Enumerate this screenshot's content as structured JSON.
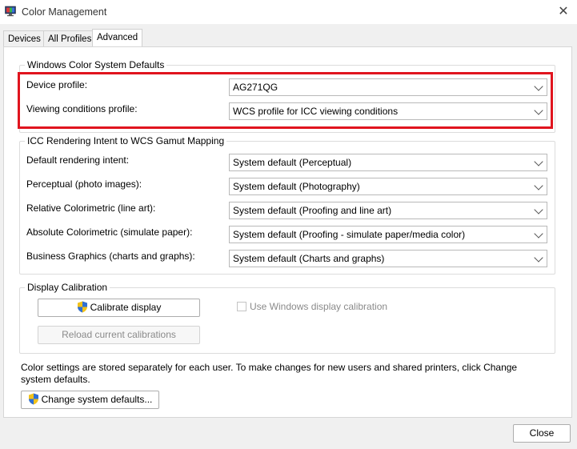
{
  "window": {
    "title": "Color Management",
    "close_glyph": "✕"
  },
  "tabs": [
    {
      "label": "Devices"
    },
    {
      "label": "All Profiles"
    },
    {
      "label": "Advanced"
    }
  ],
  "wcs_defaults": {
    "legend": "Windows Color System Defaults",
    "rows": [
      {
        "label": "Device profile:",
        "value": "AG271QG"
      },
      {
        "label": "Viewing conditions profile:",
        "value": "WCS profile for ICC viewing conditions"
      }
    ]
  },
  "icc_mapping": {
    "legend": "ICC Rendering Intent to WCS Gamut Mapping",
    "rows": [
      {
        "label": "Default rendering intent:",
        "value": "System default (Perceptual)"
      },
      {
        "label": "Perceptual (photo images):",
        "value": "System default (Photography)"
      },
      {
        "label": "Relative Colorimetric (line art):",
        "value": "System default (Proofing and line art)"
      },
      {
        "label": "Absolute Colorimetric (simulate paper):",
        "value": "System default (Proofing - simulate paper/media color)"
      },
      {
        "label": "Business Graphics (charts and graphs):",
        "value": "System default (Charts and graphs)"
      }
    ]
  },
  "calibration": {
    "legend": "Display Calibration",
    "calibrate_label": "Calibrate display",
    "reload_label": "Reload current calibrations",
    "use_windows_label": "Use Windows display calibration",
    "use_windows_checked": false
  },
  "info_text": "Color settings are stored separately for each user. To make changes for new users and shared printers, click Change system defaults.",
  "change_defaults_label": "Change system defaults...",
  "close_label": "Close",
  "colors": {
    "highlight": "#e0141e",
    "shield_blue": "#2f6fd6",
    "shield_yellow": "#f2c21b"
  },
  "icons": {
    "app": "color-management-icon",
    "shield": "uac-shield-icon",
    "close": "close-icon",
    "dropdown": "chevron-down-icon"
  }
}
